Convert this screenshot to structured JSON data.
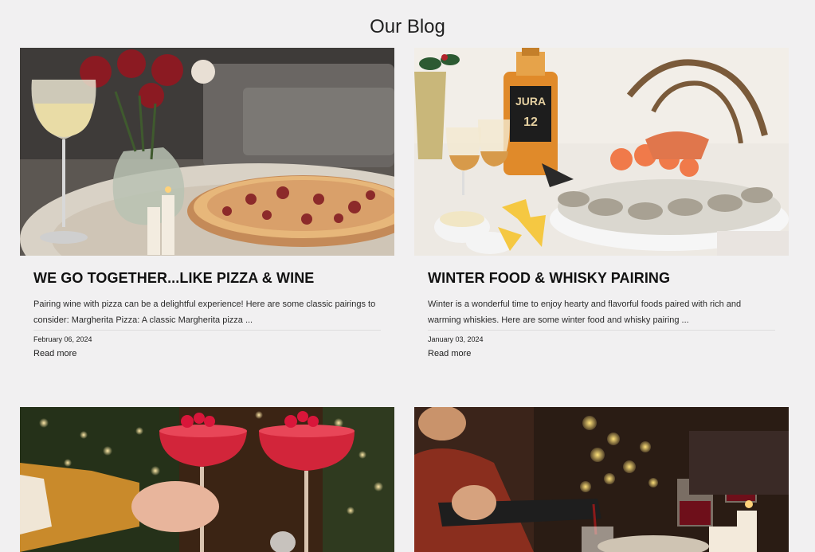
{
  "blog": {
    "heading": "Our Blog"
  },
  "posts": [
    {
      "title": "WE GO TOGETHER...LIKE PIZZA & WINE",
      "excerpt": "Pairing wine with pizza can be a delightful experience! Here are some classic pairings to consider: Margherita Pizza: A classic Margherita pizza ...",
      "date": "February 06, 2024",
      "read_more": "Read more",
      "image": "pizza-and-wine-photo"
    },
    {
      "title": "WINTER FOOD & WHISKY PAIRING",
      "excerpt": "Winter is a wonderful time to enjoy hearty and flavorful foods paired with rich and warming whiskies. Here are some winter food and whisky pairing ...",
      "date": "January 03, 2024",
      "read_more": "Read more",
      "image": "seafood-and-whisky-photo",
      "bottle_label": "JURA",
      "bottle_age": "12"
    },
    {
      "image": "red-cocktails-photo"
    },
    {
      "image": "wine-pouring-dinner-photo"
    }
  ]
}
